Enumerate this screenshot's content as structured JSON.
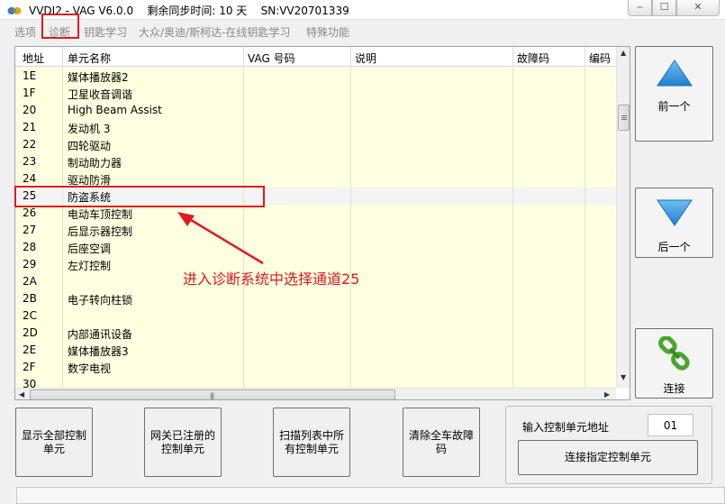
{
  "window": {
    "title": "VVDI2 - VAG V6.0.0",
    "sync_label": "剩余同步时间: 10 天",
    "serial": "SN:VV20701339",
    "minimize_glyph": "‒",
    "maximize_glyph": "☐",
    "close_glyph": "✕"
  },
  "menu": {
    "items": [
      "选项",
      "诊断",
      "钥匙学习",
      "大众/奥迪/斯柯达-在线钥匙学习",
      "特殊功能"
    ]
  },
  "table": {
    "columns": [
      "地址",
      "单元名称",
      "VAG 号码",
      "说明",
      "故障码",
      "编码"
    ],
    "rows": [
      {
        "addr": "1E",
        "name": "媒体播放器2"
      },
      {
        "addr": "1F",
        "name": "卫星收音调谐"
      },
      {
        "addr": "20",
        "name": "High Beam Assist"
      },
      {
        "addr": "21",
        "name": "发动机 3"
      },
      {
        "addr": "22",
        "name": "四轮驱动"
      },
      {
        "addr": "23",
        "name": "制动助力器"
      },
      {
        "addr": "24",
        "name": "驱动防滑"
      },
      {
        "addr": "25",
        "name": "防盗系统"
      },
      {
        "addr": "26",
        "name": "电动车顶控制"
      },
      {
        "addr": "27",
        "name": "后显示器控制"
      },
      {
        "addr": "28",
        "name": "后座空调"
      },
      {
        "addr": "29",
        "name": "左灯控制"
      },
      {
        "addr": "2A",
        "name": ""
      },
      {
        "addr": "2B",
        "name": "电子转向柱锁"
      },
      {
        "addr": "2C",
        "name": ""
      },
      {
        "addr": "2D",
        "name": "内部通讯设备"
      },
      {
        "addr": "2E",
        "name": "媒体播放器3"
      },
      {
        "addr": "2F",
        "name": "数字电视"
      },
      {
        "addr": "30",
        "name": ""
      }
    ],
    "selected_addr": "25",
    "hscroll_grip": "|||"
  },
  "annotation": {
    "text": "进入诊断系统中选择通道25"
  },
  "side_buttons": {
    "prev": "前一个",
    "next": "后一个",
    "connect": "连接"
  },
  "bottom_buttons": {
    "show_all": "显示全部控制单元",
    "gateway": "网关已注册的控制单元",
    "scan": "扫描列表中所有控制单元",
    "clear": "清除全车故障码"
  },
  "address": {
    "label": "输入控制单元地址",
    "value": "01",
    "connect_button": "连接指定控制单元"
  },
  "colors": {
    "row_bg": "#ffffe1",
    "accent_red": "#e0191e",
    "arrow_blue": "#2f8fd8",
    "link_green": "#4aa52e"
  }
}
